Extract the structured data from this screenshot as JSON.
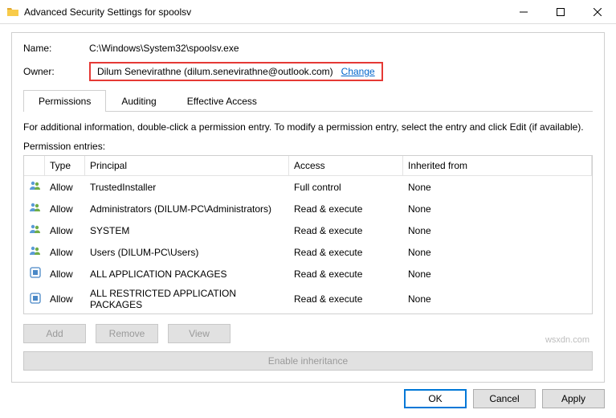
{
  "title": "Advanced Security Settings for spoolsv",
  "nameLabel": "Name:",
  "nameValue": "C:\\Windows\\System32\\spoolsv.exe",
  "ownerLabel": "Owner:",
  "ownerValue": "Dilum Senevirathne (dilum.senevirathne@outlook.com)",
  "changeLink": "Change",
  "tabs": {
    "permissions": "Permissions",
    "auditing": "Auditing",
    "effective": "Effective Access"
  },
  "infoText": "For additional information, double-click a permission entry. To modify a permission entry, select the entry and click Edit (if available).",
  "entriesLabel": "Permission entries:",
  "headers": {
    "type": "Type",
    "principal": "Principal",
    "access": "Access",
    "inherited": "Inherited from"
  },
  "entries": [
    {
      "icon": "users",
      "type": "Allow",
      "principal": "TrustedInstaller",
      "access": "Full control",
      "inherited": "None"
    },
    {
      "icon": "users",
      "type": "Allow",
      "principal": "Administrators (DILUM-PC\\Administrators)",
      "access": "Read & execute",
      "inherited": "None"
    },
    {
      "icon": "users",
      "type": "Allow",
      "principal": "SYSTEM",
      "access": "Read & execute",
      "inherited": "None"
    },
    {
      "icon": "users",
      "type": "Allow",
      "principal": "Users (DILUM-PC\\Users)",
      "access": "Read & execute",
      "inherited": "None"
    },
    {
      "icon": "package",
      "type": "Allow",
      "principal": "ALL APPLICATION PACKAGES",
      "access": "Read & execute",
      "inherited": "None"
    },
    {
      "icon": "package",
      "type": "Allow",
      "principal": "ALL RESTRICTED APPLICATION PACKAGES",
      "access": "Read & execute",
      "inherited": "None"
    }
  ],
  "buttons": {
    "add": "Add",
    "remove": "Remove",
    "view": "View",
    "enableInherit": "Enable inheritance",
    "ok": "OK",
    "cancel": "Cancel",
    "apply": "Apply"
  },
  "watermark": "wsxdn.com"
}
